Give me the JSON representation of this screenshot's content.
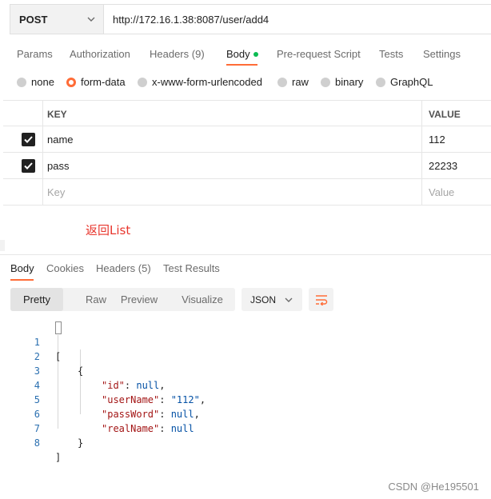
{
  "request": {
    "method": "POST",
    "url": "http://172.16.1.38:8087/user/add4"
  },
  "req_tabs": {
    "params": "Params",
    "authorization": "Authorization",
    "headers": "Headers",
    "headers_count": "(9)",
    "body": "Body",
    "prerequest": "Pre-request Script",
    "tests": "Tests",
    "settings": "Settings"
  },
  "body_types": {
    "none": "none",
    "form_data": "form-data",
    "urlencoded": "x-www-form-urlencoded",
    "raw": "raw",
    "binary": "binary",
    "graphql": "GraphQL",
    "selected": "form-data"
  },
  "params_table": {
    "key_header": "KEY",
    "value_header": "VALUE",
    "rows": [
      {
        "key": "name",
        "value": "112",
        "checked": true
      },
      {
        "key": "pass",
        "value": "22233",
        "checked": true
      }
    ],
    "key_placeholder": "Key",
    "value_placeholder": "Value"
  },
  "annotation": "返回List",
  "resp_tabs": {
    "body": "Body",
    "cookies": "Cookies",
    "headers": "Headers",
    "headers_count": "(5)",
    "test_results": "Test Results"
  },
  "toolbar": {
    "pretty": "Pretty",
    "raw": "Raw",
    "preview": "Preview",
    "visualize": "Visualize",
    "format": "JSON"
  },
  "code": {
    "line_numbers": [
      "1",
      "2",
      "3",
      "4",
      "5",
      "6",
      "7",
      "8"
    ],
    "open_bracket": "[",
    "open_brace": "{",
    "id_key": "\"id\"",
    "id_val": "null",
    "username_key": "\"userName\"",
    "username_val": "\"112\"",
    "password_key": "\"passWord\"",
    "password_val": "null",
    "realname_key": "\"realName\"",
    "realname_val": "null",
    "close_brace": "}",
    "close_bracket": "]"
  },
  "watermark": "CSDN @He195501",
  "colors": {
    "accent": "#ff6c37",
    "active_dot": "#0cbb52",
    "annotation": "#e8362d"
  }
}
